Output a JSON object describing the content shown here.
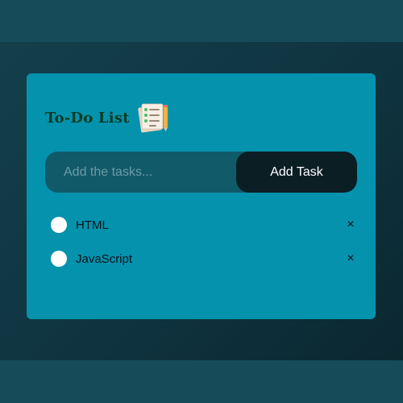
{
  "header": {
    "title": "To-Do List",
    "icon": "todo-list-icon"
  },
  "input": {
    "placeholder": "Add the tasks...",
    "value": ""
  },
  "add_button": {
    "label": "Add Task"
  },
  "tasks": [
    {
      "label": "HTML",
      "checked": false,
      "delete_symbol": "×"
    },
    {
      "label": "JavaScript",
      "checked": false,
      "delete_symbol": "×"
    }
  ],
  "colors": {
    "page_background": "#164c5a",
    "card": "#0492ad",
    "input_background": "#115a6a",
    "button": "#0b1e24",
    "title": "#0a3b22"
  }
}
